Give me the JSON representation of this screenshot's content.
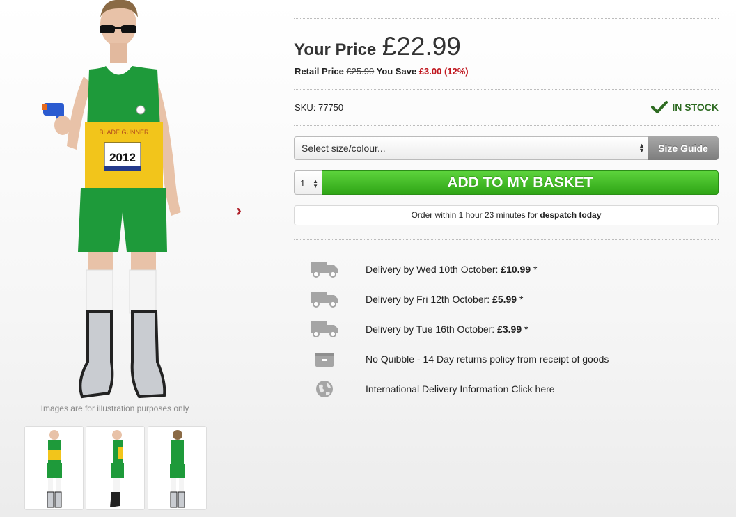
{
  "gallery": {
    "caption": "Images are for illustration purposes only",
    "thumbnails": [
      "front-view",
      "side-view",
      "back-view"
    ],
    "next_icon": "chevron-right-icon",
    "shirt_text": "BLADE GUNNER",
    "bib_number": "2012"
  },
  "price": {
    "label": "Your Price",
    "value": "£22.99",
    "retail_label": "Retail Price",
    "retail_value": "£25.99",
    "save_label": "You Save",
    "save_value": "£3.00 (12%)"
  },
  "stock": {
    "sku_label": "SKU:",
    "sku_value": "77750",
    "status": "IN STOCK",
    "status_color": "#2e6b22"
  },
  "purchase": {
    "select_placeholder": "Select size/colour...",
    "size_guide_label": "Size Guide",
    "quantity": "1",
    "add_button_label": "ADD TO MY BASKET",
    "dispatch_prefix": "Order within 1 hour 23 minutes for",
    "dispatch_bold": "despatch today"
  },
  "delivery": [
    {
      "icon": "truck-icon",
      "text": "Delivery by Wed 10th October:",
      "price": "£10.99",
      "suffix": "*"
    },
    {
      "icon": "truck-icon",
      "text": "Delivery by Fri 12th October:",
      "price": "£5.99",
      "suffix": "*"
    },
    {
      "icon": "truck-icon",
      "text": "Delivery by Tue 16th October:",
      "price": "£3.99",
      "suffix": "*"
    }
  ],
  "returns": {
    "icon": "returns-box-icon",
    "text": "No Quibble - 14 Day returns policy from receipt of goods"
  },
  "international": {
    "icon": "globe-icon",
    "text": "International Delivery Information Click here",
    "color": "#a8141c"
  }
}
